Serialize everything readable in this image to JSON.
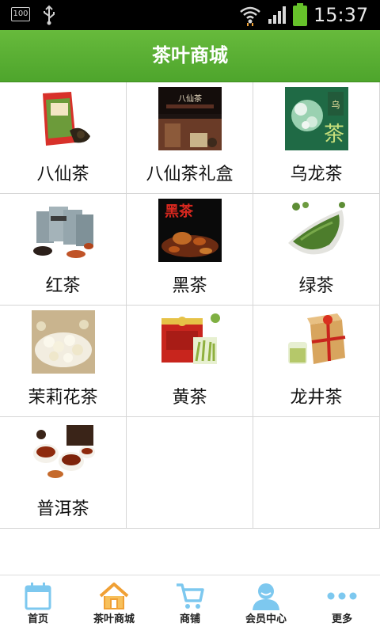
{
  "status_bar": {
    "battery_level": "100",
    "time": "15:37",
    "icons": [
      "battery-icon",
      "usb-icon",
      "wifi-icon",
      "signal-icon",
      "battery-charge-icon"
    ]
  },
  "header": {
    "title": "茶叶商城"
  },
  "colors": {
    "accent_green": "#5cb335",
    "nav_blue": "#7dc8ef",
    "nav_orange": "#f0a035"
  },
  "products": [
    {
      "label": "八仙茶"
    },
    {
      "label": "八仙茶礼盒"
    },
    {
      "label": "乌龙茶"
    },
    {
      "label": "红茶"
    },
    {
      "label": "黑茶"
    },
    {
      "label": "绿茶"
    },
    {
      "label": "茉莉花茶"
    },
    {
      "label": "黄茶"
    },
    {
      "label": "龙井茶"
    },
    {
      "label": "普洱茶"
    }
  ],
  "bottom_nav": {
    "items": [
      {
        "label": "首页",
        "icon": "calendar-icon"
      },
      {
        "label": "茶叶商城",
        "icon": "home-icon",
        "active": true
      },
      {
        "label": "商铺",
        "icon": "cart-icon"
      },
      {
        "label": "会员中心",
        "icon": "user-icon"
      },
      {
        "label": "更多",
        "icon": "more-dots-icon"
      }
    ]
  }
}
